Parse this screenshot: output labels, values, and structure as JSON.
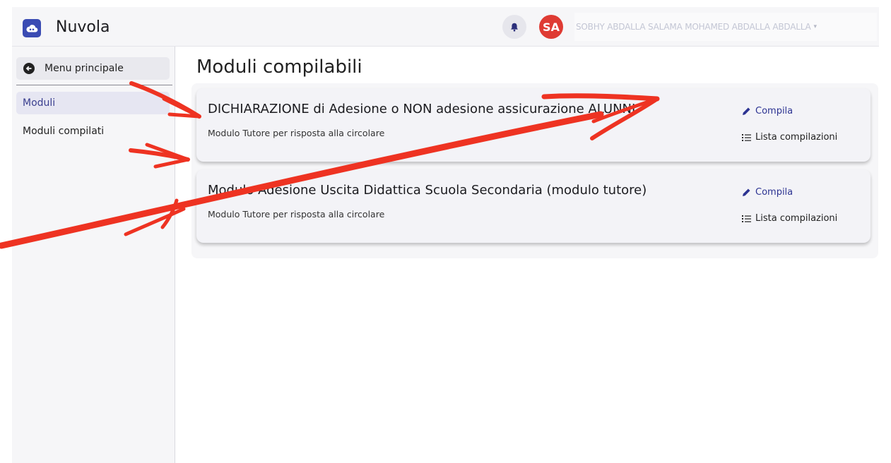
{
  "header": {
    "app_name": "Nuvola",
    "avatar_initials": "SA",
    "user_name": "SOBHY ABDALLA SALAMA MOHAMED ABDALLA ABDALLA",
    "user_caret": "▾"
  },
  "sidebar": {
    "back_label": "Menu principale",
    "items": [
      {
        "label": "Moduli",
        "active": true
      },
      {
        "label": "Moduli compilati",
        "active": false
      }
    ]
  },
  "main": {
    "title": "Moduli compilabili",
    "cards": [
      {
        "title": "DICHIARAZIONE di Adesione o NON adesione assicurazione ALUNNI",
        "subtitle": "Modulo Tutore per risposta alla circolare",
        "compila_label": "Compila",
        "lista_label": "Lista compilazioni"
      },
      {
        "title": "Modulo Adesione Uscita Didattica Scuola Secondaria (modulo tutore)",
        "subtitle": "Modulo Tutore per risposta alla circolare",
        "compila_label": "Compila",
        "lista_label": "Lista compilazioni"
      }
    ]
  },
  "colors": {
    "brand": "#3a4bb3",
    "avatar": "#df3b33",
    "link": "#2c3392",
    "annotation": "#ee3322"
  },
  "icons": {
    "logo": "cloud-icon",
    "bell": "bell-icon",
    "back": "arrow-left-circle-icon",
    "compila": "pencil-icon",
    "lista": "list-icon"
  }
}
